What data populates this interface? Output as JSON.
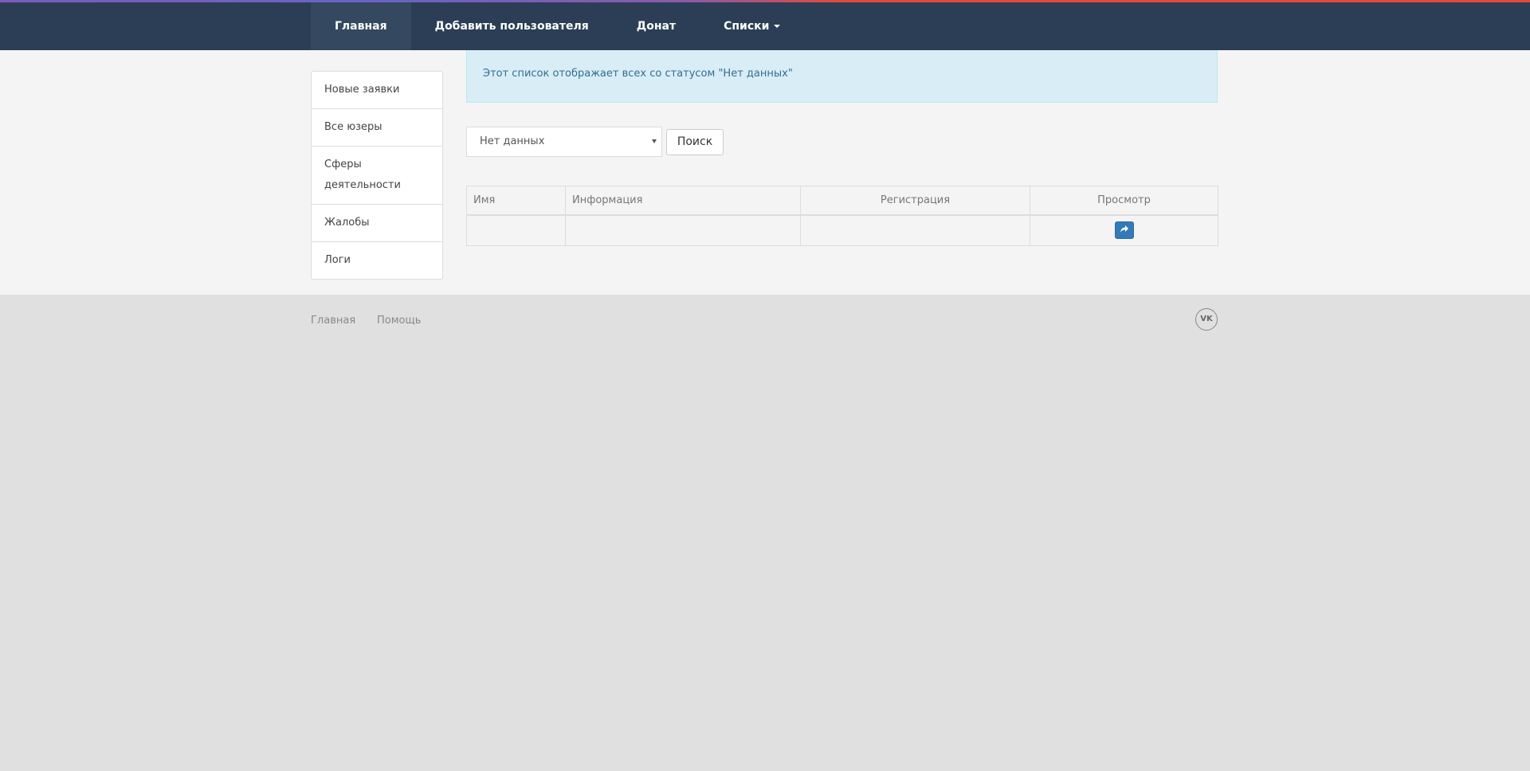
{
  "nav": {
    "items": [
      {
        "label": "Главная",
        "active": true
      },
      {
        "label": "Добавить пользователя"
      },
      {
        "label": "Донат"
      },
      {
        "label": "Списки",
        "dropdown": true
      }
    ]
  },
  "sidebar": {
    "items": [
      {
        "label": "Новые заявки"
      },
      {
        "label": "Все юзеры"
      },
      {
        "label": "Сферы деятельности"
      },
      {
        "label": "Жалобы"
      },
      {
        "label": "Логи"
      }
    ]
  },
  "alert": {
    "text": "Этот список отображает всех со статусом \"Нет данных\""
  },
  "filter": {
    "selected": "Нет данных",
    "search_label": "Поиск"
  },
  "table": {
    "headers": [
      "Имя",
      "Информация",
      "Регистрация",
      "Просмотр"
    ],
    "rows": [
      [
        "",
        "",
        "",
        ""
      ]
    ]
  },
  "footer": {
    "links": [
      "Главная",
      "Помощь"
    ],
    "social_icon": "vk-icon",
    "social_label": "VK"
  },
  "colors": {
    "navbar": "#2b3e55",
    "nav_active": "#34485f",
    "alert_bg": "#d9edf7",
    "alert_text": "#31708f",
    "primary": "#337ab7"
  }
}
